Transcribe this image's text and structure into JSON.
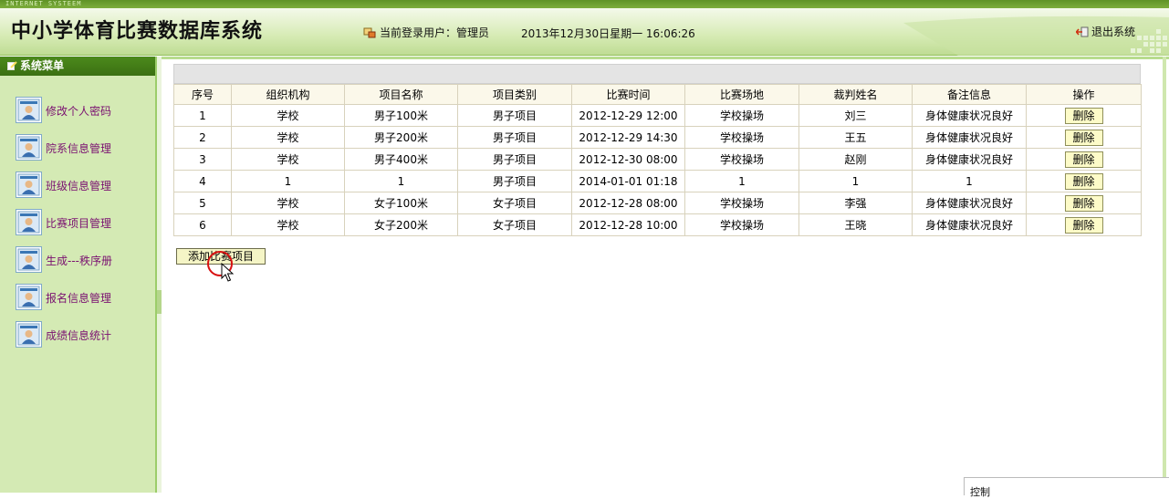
{
  "topbar": {
    "label": "INTERNET SYSTEEM"
  },
  "header": {
    "title": "中小学体育比赛数据库系统",
    "user_label": "当前登录用户：管理员",
    "datetime": "2013年12月30日星期一  16:06:26",
    "logout_label": "退出系统"
  },
  "sidebar": {
    "heading": "系统菜单",
    "items": [
      {
        "label": "修改个人密码"
      },
      {
        "label": "院系信息管理"
      },
      {
        "label": "班级信息管理"
      },
      {
        "label": "比赛项目管理"
      },
      {
        "label": "生成---秩序册"
      },
      {
        "label": "报名信息管理"
      },
      {
        "label": "成绩信息统计"
      }
    ]
  },
  "table": {
    "headers": [
      "序号",
      "组织机构",
      "项目名称",
      "项目类别",
      "比赛时间",
      "比赛场地",
      "裁判姓名",
      "备注信息",
      "操作"
    ],
    "rows": [
      [
        "1",
        "学校",
        "男子100米",
        "男子项目",
        "2012-12-29 12:00",
        "学校操场",
        "刘三",
        "身体健康状况良好"
      ],
      [
        "2",
        "学校",
        "男子200米",
        "男子项目",
        "2012-12-29 14:30",
        "学校操场",
        "王五",
        "身体健康状况良好"
      ],
      [
        "3",
        "学校",
        "男子400米",
        "男子项目",
        "2012-12-30 08:00",
        "学校操场",
        "赵刚",
        "身体健康状况良好"
      ],
      [
        "4",
        "1",
        "1",
        "男子项目",
        "2014-01-01 01:18",
        "1",
        "1",
        "1"
      ],
      [
        "5",
        "学校",
        "女子100米",
        "女子项目",
        "2012-12-28 08:00",
        "学校操场",
        "李强",
        "身体健康状况良好"
      ],
      [
        "6",
        "学校",
        "女子200米",
        "女子项目",
        "2012-12-28 10:00",
        "学校操场",
        "王晓",
        "身体健康状况良好"
      ]
    ],
    "delete_label": "删除"
  },
  "add_button": "添加比赛项目",
  "control_panel": {
    "label": "控制"
  },
  "colors": {
    "accent": "#4c8a1c",
    "sidebar_bg": "#d4eab4",
    "menu_text": "#7a1070"
  }
}
